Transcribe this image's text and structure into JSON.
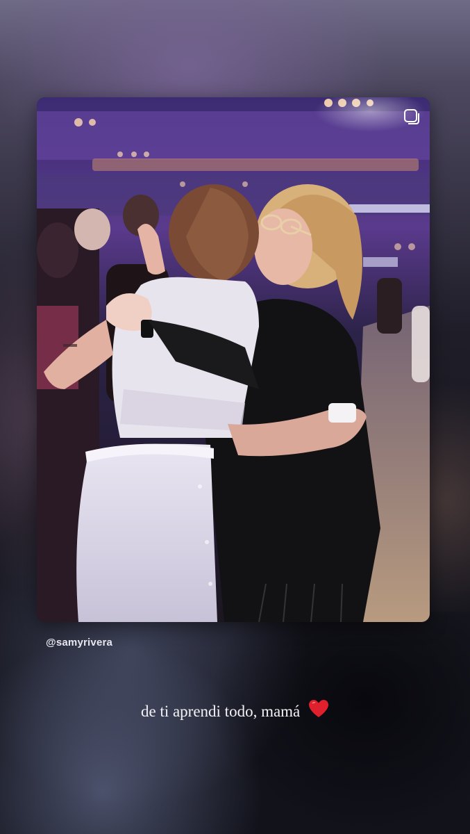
{
  "story": {
    "shared_post": {
      "author_handle": "@samyrivera",
      "image_description_icon": "photo-thumbnail"
    },
    "caption": {
      "text": "de ti aprendi todo, mamá",
      "emoji": "red-heart-icon"
    }
  },
  "colors": {
    "heart": "#e0202c",
    "caption_text": "#f4f2f6",
    "handle_text": "#e8e6ee"
  }
}
